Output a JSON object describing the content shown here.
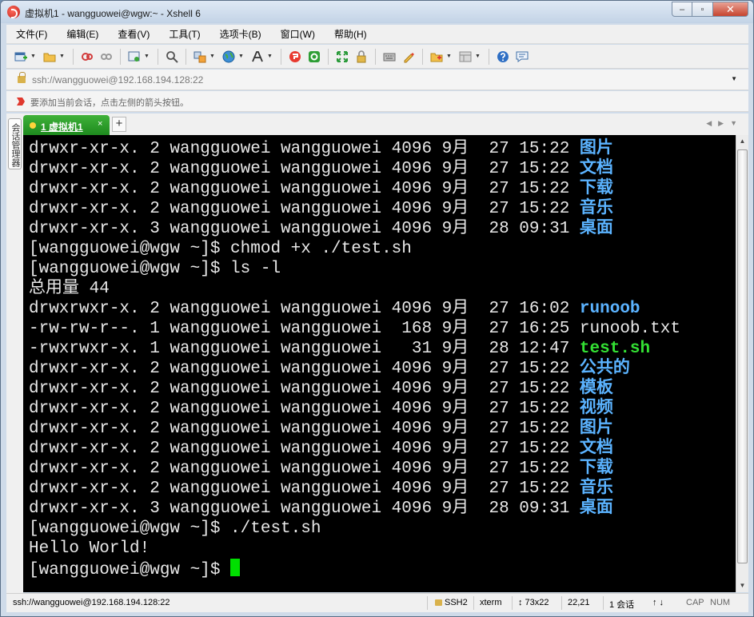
{
  "window": {
    "title": "虚拟机1 - wangguowei@wgw:~ - Xshell 6",
    "minimize": "‒",
    "maximize": "▫",
    "close": "✕"
  },
  "menu": [
    "文件(F)",
    "编辑(E)",
    "查看(V)",
    "工具(T)",
    "选项卡(B)",
    "窗口(W)",
    "帮助(H)"
  ],
  "address": {
    "value": "ssh://wangguowei@192.168.194.128:22"
  },
  "hint": {
    "text": "要添加当前会话，点击左侧的箭头按钮。"
  },
  "tabs": [
    {
      "label": "1 虚拟机1",
      "close": "×"
    }
  ],
  "tab_add": "+",
  "sidebar": {
    "label": "会话管理器"
  },
  "terminal": {
    "lines": [
      [
        {
          "t": "drwxr-xr-x. 2 wangguowei wangguowei 4096 9月  27 15:22 ",
          "c": "norm"
        },
        {
          "t": "图片",
          "c": "dir"
        }
      ],
      [
        {
          "t": "drwxr-xr-x. 2 wangguowei wangguowei 4096 9月  27 15:22 ",
          "c": "norm"
        },
        {
          "t": "文档",
          "c": "dir"
        }
      ],
      [
        {
          "t": "drwxr-xr-x. 2 wangguowei wangguowei 4096 9月  27 15:22 ",
          "c": "norm"
        },
        {
          "t": "下载",
          "c": "dir"
        }
      ],
      [
        {
          "t": "drwxr-xr-x. 2 wangguowei wangguowei 4096 9月  27 15:22 ",
          "c": "norm"
        },
        {
          "t": "音乐",
          "c": "dir"
        }
      ],
      [
        {
          "t": "drwxr-xr-x. 3 wangguowei wangguowei 4096 9月  28 09:31 ",
          "c": "norm"
        },
        {
          "t": "桌面",
          "c": "dir"
        }
      ],
      [
        {
          "t": "[wangguowei@wgw ~]$ chmod +x ./test.sh",
          "c": "norm"
        }
      ],
      [
        {
          "t": "[wangguowei@wgw ~]$ ls -l",
          "c": "norm"
        }
      ],
      [
        {
          "t": "总用量 44",
          "c": "norm"
        }
      ],
      [
        {
          "t": "drwxrwxr-x. 2 wangguowei wangguowei 4096 9月  27 16:02 ",
          "c": "norm"
        },
        {
          "t": "runoob",
          "c": "dir"
        }
      ],
      [
        {
          "t": "-rw-rw-r--. 1 wangguowei wangguowei  168 9月  27 16:25 runoob.txt",
          "c": "norm"
        }
      ],
      [
        {
          "t": "-rwxrwxr-x. 1 wangguowei wangguowei   31 9月  28 12:47 ",
          "c": "norm"
        },
        {
          "t": "test.sh",
          "c": "exec"
        }
      ],
      [
        {
          "t": "drwxr-xr-x. 2 wangguowei wangguowei 4096 9月  27 15:22 ",
          "c": "norm"
        },
        {
          "t": "公共的",
          "c": "dir"
        }
      ],
      [
        {
          "t": "drwxr-xr-x. 2 wangguowei wangguowei 4096 9月  27 15:22 ",
          "c": "norm"
        },
        {
          "t": "模板",
          "c": "dir"
        }
      ],
      [
        {
          "t": "drwxr-xr-x. 2 wangguowei wangguowei 4096 9月  27 15:22 ",
          "c": "norm"
        },
        {
          "t": "视频",
          "c": "dir"
        }
      ],
      [
        {
          "t": "drwxr-xr-x. 2 wangguowei wangguowei 4096 9月  27 15:22 ",
          "c": "norm"
        },
        {
          "t": "图片",
          "c": "dir"
        }
      ],
      [
        {
          "t": "drwxr-xr-x. 2 wangguowei wangguowei 4096 9月  27 15:22 ",
          "c": "norm"
        },
        {
          "t": "文档",
          "c": "dir"
        }
      ],
      [
        {
          "t": "drwxr-xr-x. 2 wangguowei wangguowei 4096 9月  27 15:22 ",
          "c": "norm"
        },
        {
          "t": "下载",
          "c": "dir"
        }
      ],
      [
        {
          "t": "drwxr-xr-x. 2 wangguowei wangguowei 4096 9月  27 15:22 ",
          "c": "norm"
        },
        {
          "t": "音乐",
          "c": "dir"
        }
      ],
      [
        {
          "t": "drwxr-xr-x. 3 wangguowei wangguowei 4096 9月  28 09:31 ",
          "c": "norm"
        },
        {
          "t": "桌面",
          "c": "dir"
        }
      ],
      [
        {
          "t": "[wangguowei@wgw ~]$ ./test.sh",
          "c": "norm"
        }
      ],
      [
        {
          "t": "Hello World!",
          "c": "norm"
        }
      ],
      [
        {
          "t": "[wangguowei@wgw ~]$ ",
          "c": "norm"
        }
      ]
    ]
  },
  "status": {
    "connection": "ssh://wangguowei@192.168.194.128:22",
    "protocol": "SSH2",
    "term": "xterm",
    "size": "↕ 73x22",
    "cursor_pos": "22,21",
    "sessions": "1 会话",
    "caps": "CAP",
    "num": "NUM"
  },
  "colors": {
    "terminal_bg": "#000000",
    "terminal_fg": "#e8e8e8",
    "directory": "#5bb3ff",
    "executable": "#33e033",
    "tab_active": "#2a9a27",
    "cursor": "#00e000"
  }
}
